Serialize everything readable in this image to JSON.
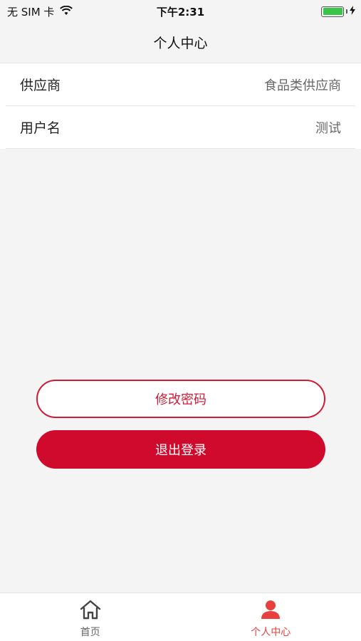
{
  "status_bar": {
    "carrier": "无 SIM 卡",
    "time": "下午2:31"
  },
  "nav": {
    "title": "个人中心"
  },
  "info": {
    "rows": [
      {
        "label": "供应商",
        "value": "食品类供应商"
      },
      {
        "label": "用户名",
        "value": "测试"
      }
    ]
  },
  "actions": {
    "change_password": "修改密码",
    "logout": "退出登录"
  },
  "tabbar": {
    "tabs": [
      {
        "label": "首页",
        "icon": "home-icon",
        "active": false
      },
      {
        "label": "个人中心",
        "icon": "person-icon",
        "active": true
      }
    ]
  },
  "colors": {
    "accent": "#cf0a2c",
    "tab_active": "#e8403f",
    "battery": "#3ac44a",
    "background": "#f4f4f5"
  }
}
